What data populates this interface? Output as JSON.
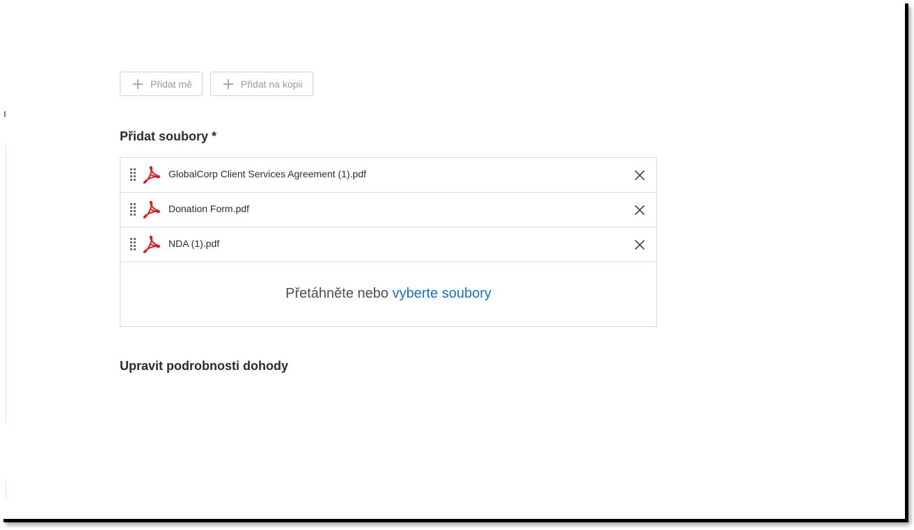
{
  "buttons": {
    "add_me": "Přidat mě",
    "add_cc": "Přidat na kopii"
  },
  "files_section": {
    "title": "Přidat soubory *",
    "files": [
      {
        "name": "GlobalCorp Client Services Agreement (1).pdf",
        "icon": "pdf-icon"
      },
      {
        "name": "Donation Form.pdf",
        "icon": "pdf-icon"
      },
      {
        "name": "NDA (1).pdf",
        "icon": "pdf-icon"
      }
    ],
    "drop_text": "Přetáhněte nebo",
    "drop_link": "vyberte soubory"
  },
  "details_section": {
    "title": "Upravit podrobnosti dohody"
  },
  "colors": {
    "link": "#1473c5",
    "pdf_red": "#e0191f",
    "border": "#d6d6d6"
  }
}
